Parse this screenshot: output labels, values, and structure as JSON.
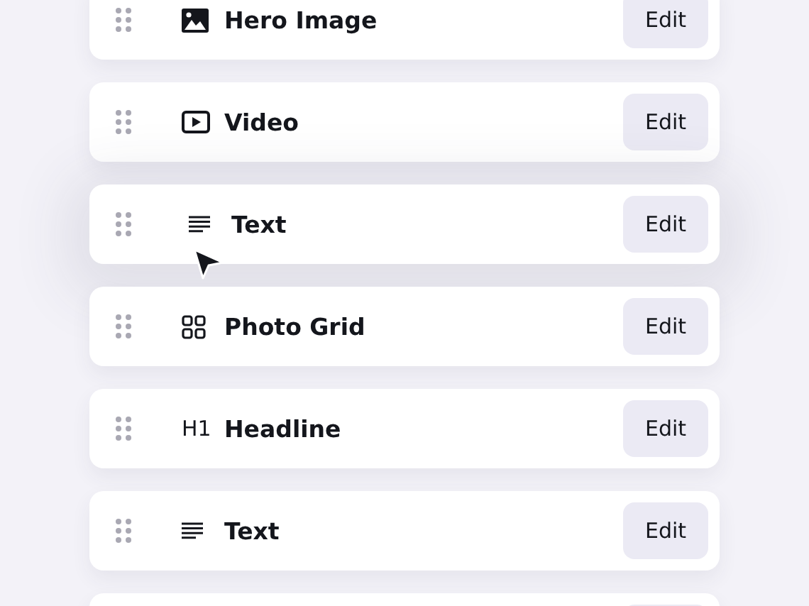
{
  "blocks": [
    {
      "kind": "image",
      "label": "Hero Image",
      "button": "Edit",
      "dragging": false
    },
    {
      "kind": "video",
      "label": "Video",
      "button": "Edit",
      "dragging": false
    },
    {
      "kind": "text",
      "label": "Text",
      "button": "Edit",
      "dragging": true
    },
    {
      "kind": "grid",
      "label": "Photo Grid",
      "button": "Edit",
      "dragging": false
    },
    {
      "kind": "heading",
      "icon_text": "H1",
      "label": "Headline",
      "button": "Edit",
      "dragging": false
    },
    {
      "kind": "text",
      "label": "Text",
      "button": "Edit",
      "dragging": false
    }
  ]
}
